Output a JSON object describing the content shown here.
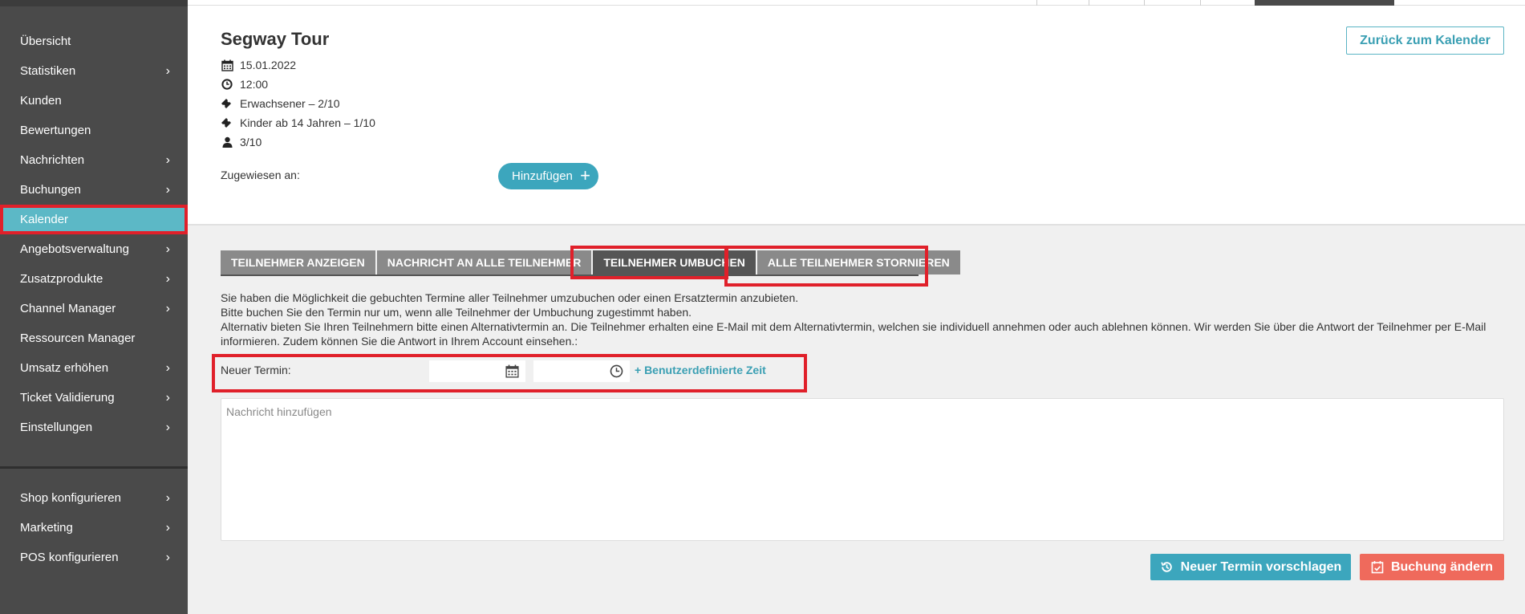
{
  "sidebar": {
    "items": [
      {
        "label": "Übersicht",
        "has_children": false
      },
      {
        "label": "Statistiken",
        "has_children": true
      },
      {
        "label": "Kunden",
        "has_children": false
      },
      {
        "label": "Bewertungen",
        "has_children": false
      },
      {
        "label": "Nachrichten",
        "has_children": true
      },
      {
        "label": "Buchungen",
        "has_children": true
      },
      {
        "label": "Kalender",
        "has_children": false,
        "active": true
      },
      {
        "label": "Angebotsverwaltung",
        "has_children": true
      },
      {
        "label": "Zusatzprodukte",
        "has_children": true
      },
      {
        "label": "Channel Manager",
        "has_children": true
      },
      {
        "label": "Ressourcen Manager",
        "has_children": false
      },
      {
        "label": "Umsatz erhöhen",
        "has_children": true
      },
      {
        "label": "Ticket Validierung",
        "has_children": true
      },
      {
        "label": "Einstellungen",
        "has_children": true
      }
    ],
    "bottom_items": [
      {
        "label": "Shop konfigurieren",
        "has_children": true
      },
      {
        "label": "Marketing",
        "has_children": true
      },
      {
        "label": "POS konfigurieren",
        "has_children": true
      }
    ],
    "chevron": "›"
  },
  "event": {
    "title": "Segway Tour",
    "date": "15.01.2022",
    "time": "12:00",
    "ticket_adult": "Erwachsener – 2/10",
    "ticket_children": "Kinder ab 14 Jahren – 1/10",
    "capacity": "3/10",
    "back_button": "Zurück zum Kalender",
    "assigned_label": "Zugewiesen an:",
    "add_button": "Hinzufügen",
    "add_icon": "+"
  },
  "tabs": [
    {
      "label": "TEILNEHMER ANZEIGEN",
      "active": false
    },
    {
      "label": "NACHRICHT AN ALLE TEILNEHMER",
      "active": false
    },
    {
      "label": "TEILNEHMER UMBUCHEN",
      "active": true
    },
    {
      "label": "ALLE TEILNEHMER STORNIEREN",
      "active": false
    }
  ],
  "description": {
    "line1": "Sie haben die Möglichkeit die gebuchten Termine aller Teilnehmer umzubuchen oder einen Ersatztermin anzubieten.",
    "line2": "Bitte buchen Sie den Termin nur um, wenn alle Teilnehmer der Umbuchung zugestimmt haben.",
    "line3": "Alternativ bieten Sie Ihren Teilnehmern bitte einen Alternativtermin an. Die Teilnehmer erhalten eine E-Mail mit dem Alternativtermin, welchen sie individuell annehmen oder auch ablehnen können. Wir werden Sie über die Antwort der Teilnehmer per E-Mail informieren. Zudem können Sie die Antwort in Ihrem Account einsehen.:"
  },
  "new_term": {
    "label": "Neuer Termin:",
    "date_value": "",
    "time_value": "",
    "custom_time_link": "+ Benutzerdefinierte Zeit"
  },
  "message": {
    "placeholder": "Nachricht hinzufügen",
    "value": ""
  },
  "actions": {
    "propose_label": "Neuer Termin vorschlagen",
    "change_label": "Buchung ändern"
  },
  "colors": {
    "sidebar_bg": "#4a4a4a",
    "active_nav": "#5cb8c6",
    "highlight": "#e0202a",
    "primary": "#3ca6bd",
    "danger": "#ef6a5c"
  },
  "icons": [
    "calendar-icon",
    "clock-icon",
    "ticket-icon",
    "user-icon",
    "plus-icon",
    "history-icon",
    "calendar-check-icon",
    "chevron-right-icon"
  ]
}
